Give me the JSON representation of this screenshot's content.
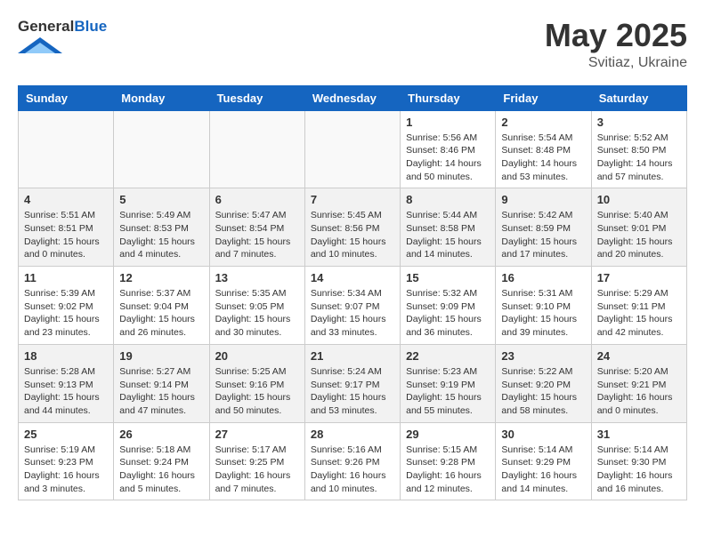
{
  "header": {
    "logo_general": "General",
    "logo_blue": "Blue",
    "month": "May 2025",
    "location": "Svitiaz, Ukraine"
  },
  "days_of_week": [
    "Sunday",
    "Monday",
    "Tuesday",
    "Wednesday",
    "Thursday",
    "Friday",
    "Saturday"
  ],
  "weeks": [
    {
      "shade": false,
      "days": [
        {
          "num": "",
          "info": ""
        },
        {
          "num": "",
          "info": ""
        },
        {
          "num": "",
          "info": ""
        },
        {
          "num": "",
          "info": ""
        },
        {
          "num": "1",
          "info": "Sunrise: 5:56 AM\nSunset: 8:46 PM\nDaylight: 14 hours\nand 50 minutes."
        },
        {
          "num": "2",
          "info": "Sunrise: 5:54 AM\nSunset: 8:48 PM\nDaylight: 14 hours\nand 53 minutes."
        },
        {
          "num": "3",
          "info": "Sunrise: 5:52 AM\nSunset: 8:50 PM\nDaylight: 14 hours\nand 57 minutes."
        }
      ]
    },
    {
      "shade": true,
      "days": [
        {
          "num": "4",
          "info": "Sunrise: 5:51 AM\nSunset: 8:51 PM\nDaylight: 15 hours\nand 0 minutes."
        },
        {
          "num": "5",
          "info": "Sunrise: 5:49 AM\nSunset: 8:53 PM\nDaylight: 15 hours\nand 4 minutes."
        },
        {
          "num": "6",
          "info": "Sunrise: 5:47 AM\nSunset: 8:54 PM\nDaylight: 15 hours\nand 7 minutes."
        },
        {
          "num": "7",
          "info": "Sunrise: 5:45 AM\nSunset: 8:56 PM\nDaylight: 15 hours\nand 10 minutes."
        },
        {
          "num": "8",
          "info": "Sunrise: 5:44 AM\nSunset: 8:58 PM\nDaylight: 15 hours\nand 14 minutes."
        },
        {
          "num": "9",
          "info": "Sunrise: 5:42 AM\nSunset: 8:59 PM\nDaylight: 15 hours\nand 17 minutes."
        },
        {
          "num": "10",
          "info": "Sunrise: 5:40 AM\nSunset: 9:01 PM\nDaylight: 15 hours\nand 20 minutes."
        }
      ]
    },
    {
      "shade": false,
      "days": [
        {
          "num": "11",
          "info": "Sunrise: 5:39 AM\nSunset: 9:02 PM\nDaylight: 15 hours\nand 23 minutes."
        },
        {
          "num": "12",
          "info": "Sunrise: 5:37 AM\nSunset: 9:04 PM\nDaylight: 15 hours\nand 26 minutes."
        },
        {
          "num": "13",
          "info": "Sunrise: 5:35 AM\nSunset: 9:05 PM\nDaylight: 15 hours\nand 30 minutes."
        },
        {
          "num": "14",
          "info": "Sunrise: 5:34 AM\nSunset: 9:07 PM\nDaylight: 15 hours\nand 33 minutes."
        },
        {
          "num": "15",
          "info": "Sunrise: 5:32 AM\nSunset: 9:09 PM\nDaylight: 15 hours\nand 36 minutes."
        },
        {
          "num": "16",
          "info": "Sunrise: 5:31 AM\nSunset: 9:10 PM\nDaylight: 15 hours\nand 39 minutes."
        },
        {
          "num": "17",
          "info": "Sunrise: 5:29 AM\nSunset: 9:11 PM\nDaylight: 15 hours\nand 42 minutes."
        }
      ]
    },
    {
      "shade": true,
      "days": [
        {
          "num": "18",
          "info": "Sunrise: 5:28 AM\nSunset: 9:13 PM\nDaylight: 15 hours\nand 44 minutes."
        },
        {
          "num": "19",
          "info": "Sunrise: 5:27 AM\nSunset: 9:14 PM\nDaylight: 15 hours\nand 47 minutes."
        },
        {
          "num": "20",
          "info": "Sunrise: 5:25 AM\nSunset: 9:16 PM\nDaylight: 15 hours\nand 50 minutes."
        },
        {
          "num": "21",
          "info": "Sunrise: 5:24 AM\nSunset: 9:17 PM\nDaylight: 15 hours\nand 53 minutes."
        },
        {
          "num": "22",
          "info": "Sunrise: 5:23 AM\nSunset: 9:19 PM\nDaylight: 15 hours\nand 55 minutes."
        },
        {
          "num": "23",
          "info": "Sunrise: 5:22 AM\nSunset: 9:20 PM\nDaylight: 15 hours\nand 58 minutes."
        },
        {
          "num": "24",
          "info": "Sunrise: 5:20 AM\nSunset: 9:21 PM\nDaylight: 16 hours\nand 0 minutes."
        }
      ]
    },
    {
      "shade": false,
      "days": [
        {
          "num": "25",
          "info": "Sunrise: 5:19 AM\nSunset: 9:23 PM\nDaylight: 16 hours\nand 3 minutes."
        },
        {
          "num": "26",
          "info": "Sunrise: 5:18 AM\nSunset: 9:24 PM\nDaylight: 16 hours\nand 5 minutes."
        },
        {
          "num": "27",
          "info": "Sunrise: 5:17 AM\nSunset: 9:25 PM\nDaylight: 16 hours\nand 7 minutes."
        },
        {
          "num": "28",
          "info": "Sunrise: 5:16 AM\nSunset: 9:26 PM\nDaylight: 16 hours\nand 10 minutes."
        },
        {
          "num": "29",
          "info": "Sunrise: 5:15 AM\nSunset: 9:28 PM\nDaylight: 16 hours\nand 12 minutes."
        },
        {
          "num": "30",
          "info": "Sunrise: 5:14 AM\nSunset: 9:29 PM\nDaylight: 16 hours\nand 14 minutes."
        },
        {
          "num": "31",
          "info": "Sunrise: 5:14 AM\nSunset: 9:30 PM\nDaylight: 16 hours\nand 16 minutes."
        }
      ]
    }
  ]
}
